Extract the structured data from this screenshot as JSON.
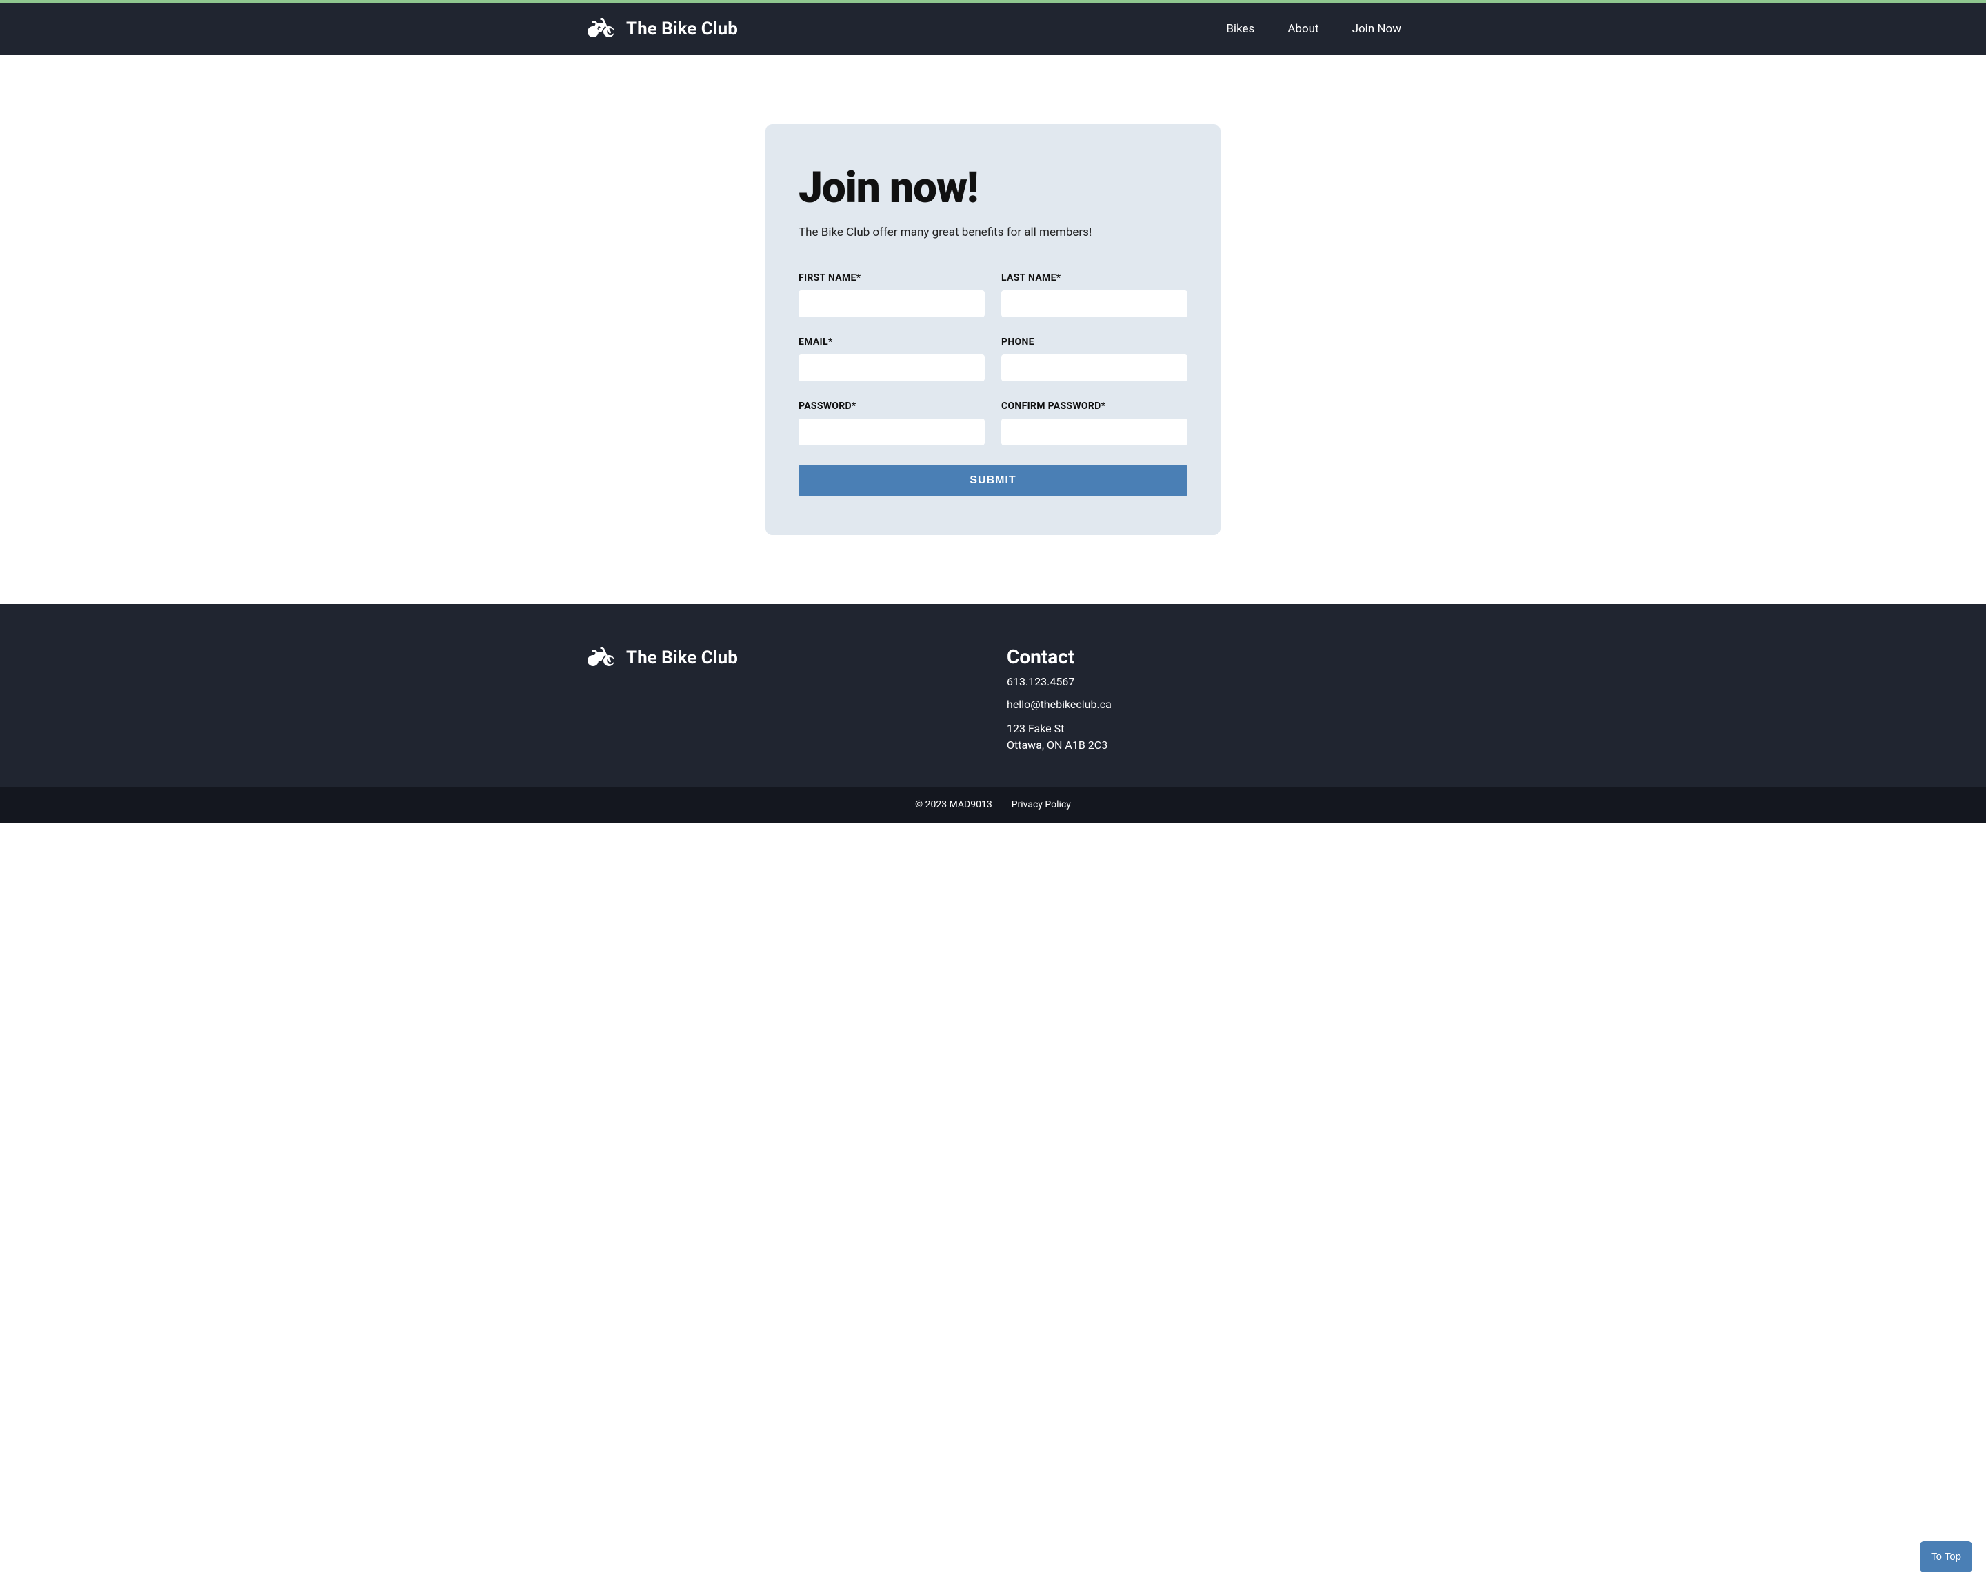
{
  "header": {
    "logo_text": "The Bike Club",
    "nav": [
      {
        "label": "Bikes"
      },
      {
        "label": "About"
      },
      {
        "label": "Join Now"
      }
    ]
  },
  "form": {
    "title": "Join now!",
    "subtitle": "The Bike Club offer many great benefits for all members!",
    "fields": {
      "first_name": {
        "label": "FIRST NAME*"
      },
      "last_name": {
        "label": "LAST NAME*"
      },
      "email": {
        "label": "EMAIL*"
      },
      "phone": {
        "label": "PHONE"
      },
      "password": {
        "label": "PASSWORD*"
      },
      "confirm_password": {
        "label": "CONFIRM PASSWORD*"
      }
    },
    "submit_label": "SUBMIT"
  },
  "footer": {
    "logo_text": "The Bike Club",
    "contact": {
      "heading": "Contact",
      "phone": "613.123.4567",
      "email": "hello@thebikeclub.ca",
      "address_line1": "123 Fake St",
      "address_line2": "Ottawa, ON A1B 2C3"
    },
    "copyright": "© 2023 MAD9013",
    "privacy_label": "Privacy Policy"
  },
  "to_top_label": "To Top"
}
